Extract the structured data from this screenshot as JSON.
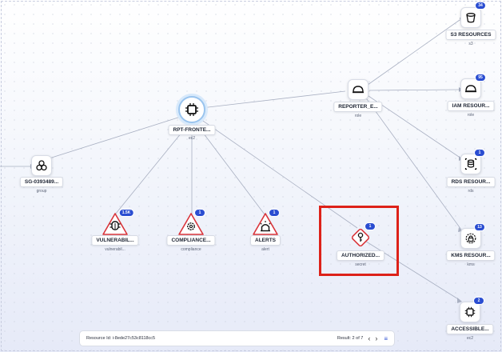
{
  "nodes": {
    "main": {
      "label": "RPT-FRONTE...",
      "sub": "ec2"
    },
    "group": {
      "label": "SG-0393489...",
      "sub": "group"
    },
    "reporter": {
      "label": "REPORTER_E...",
      "sub": "role"
    },
    "s3": {
      "label": "S3 RESOURCES",
      "sub": "s3",
      "badge": "34"
    },
    "iam": {
      "label": "IAM RESOUR...",
      "sub": "role",
      "badge": "95"
    },
    "rds": {
      "label": "RDS RESOUR...",
      "sub": "rds",
      "badge": "1"
    },
    "kms": {
      "label": "KMS RESOUR...",
      "sub": "kms",
      "badge": "13"
    },
    "accessible": {
      "label": "ACCESSIBLE...",
      "sub": "ec2",
      "badge": "2"
    },
    "vuln": {
      "label": "VULNERABIL...",
      "sub": "vulnerabil...",
      "badge": "1.5K"
    },
    "compliance": {
      "label": "COMPLIANCE...",
      "sub": "compliance",
      "badge": "1"
    },
    "alerts": {
      "label": "ALERTS",
      "sub": "alert",
      "badge": "1"
    },
    "authorized": {
      "label": "AUTHORIZED...",
      "sub": "secret",
      "badge": "1"
    }
  },
  "bottombar": {
    "resource_id": "Resource Id: i-8ede27c53c8118cc5",
    "result": "Result: 2 of 7"
  },
  "colors": {
    "accent": "#2a4dd1",
    "alert_red": "#d9343a",
    "highlight": "#dd2219"
  }
}
